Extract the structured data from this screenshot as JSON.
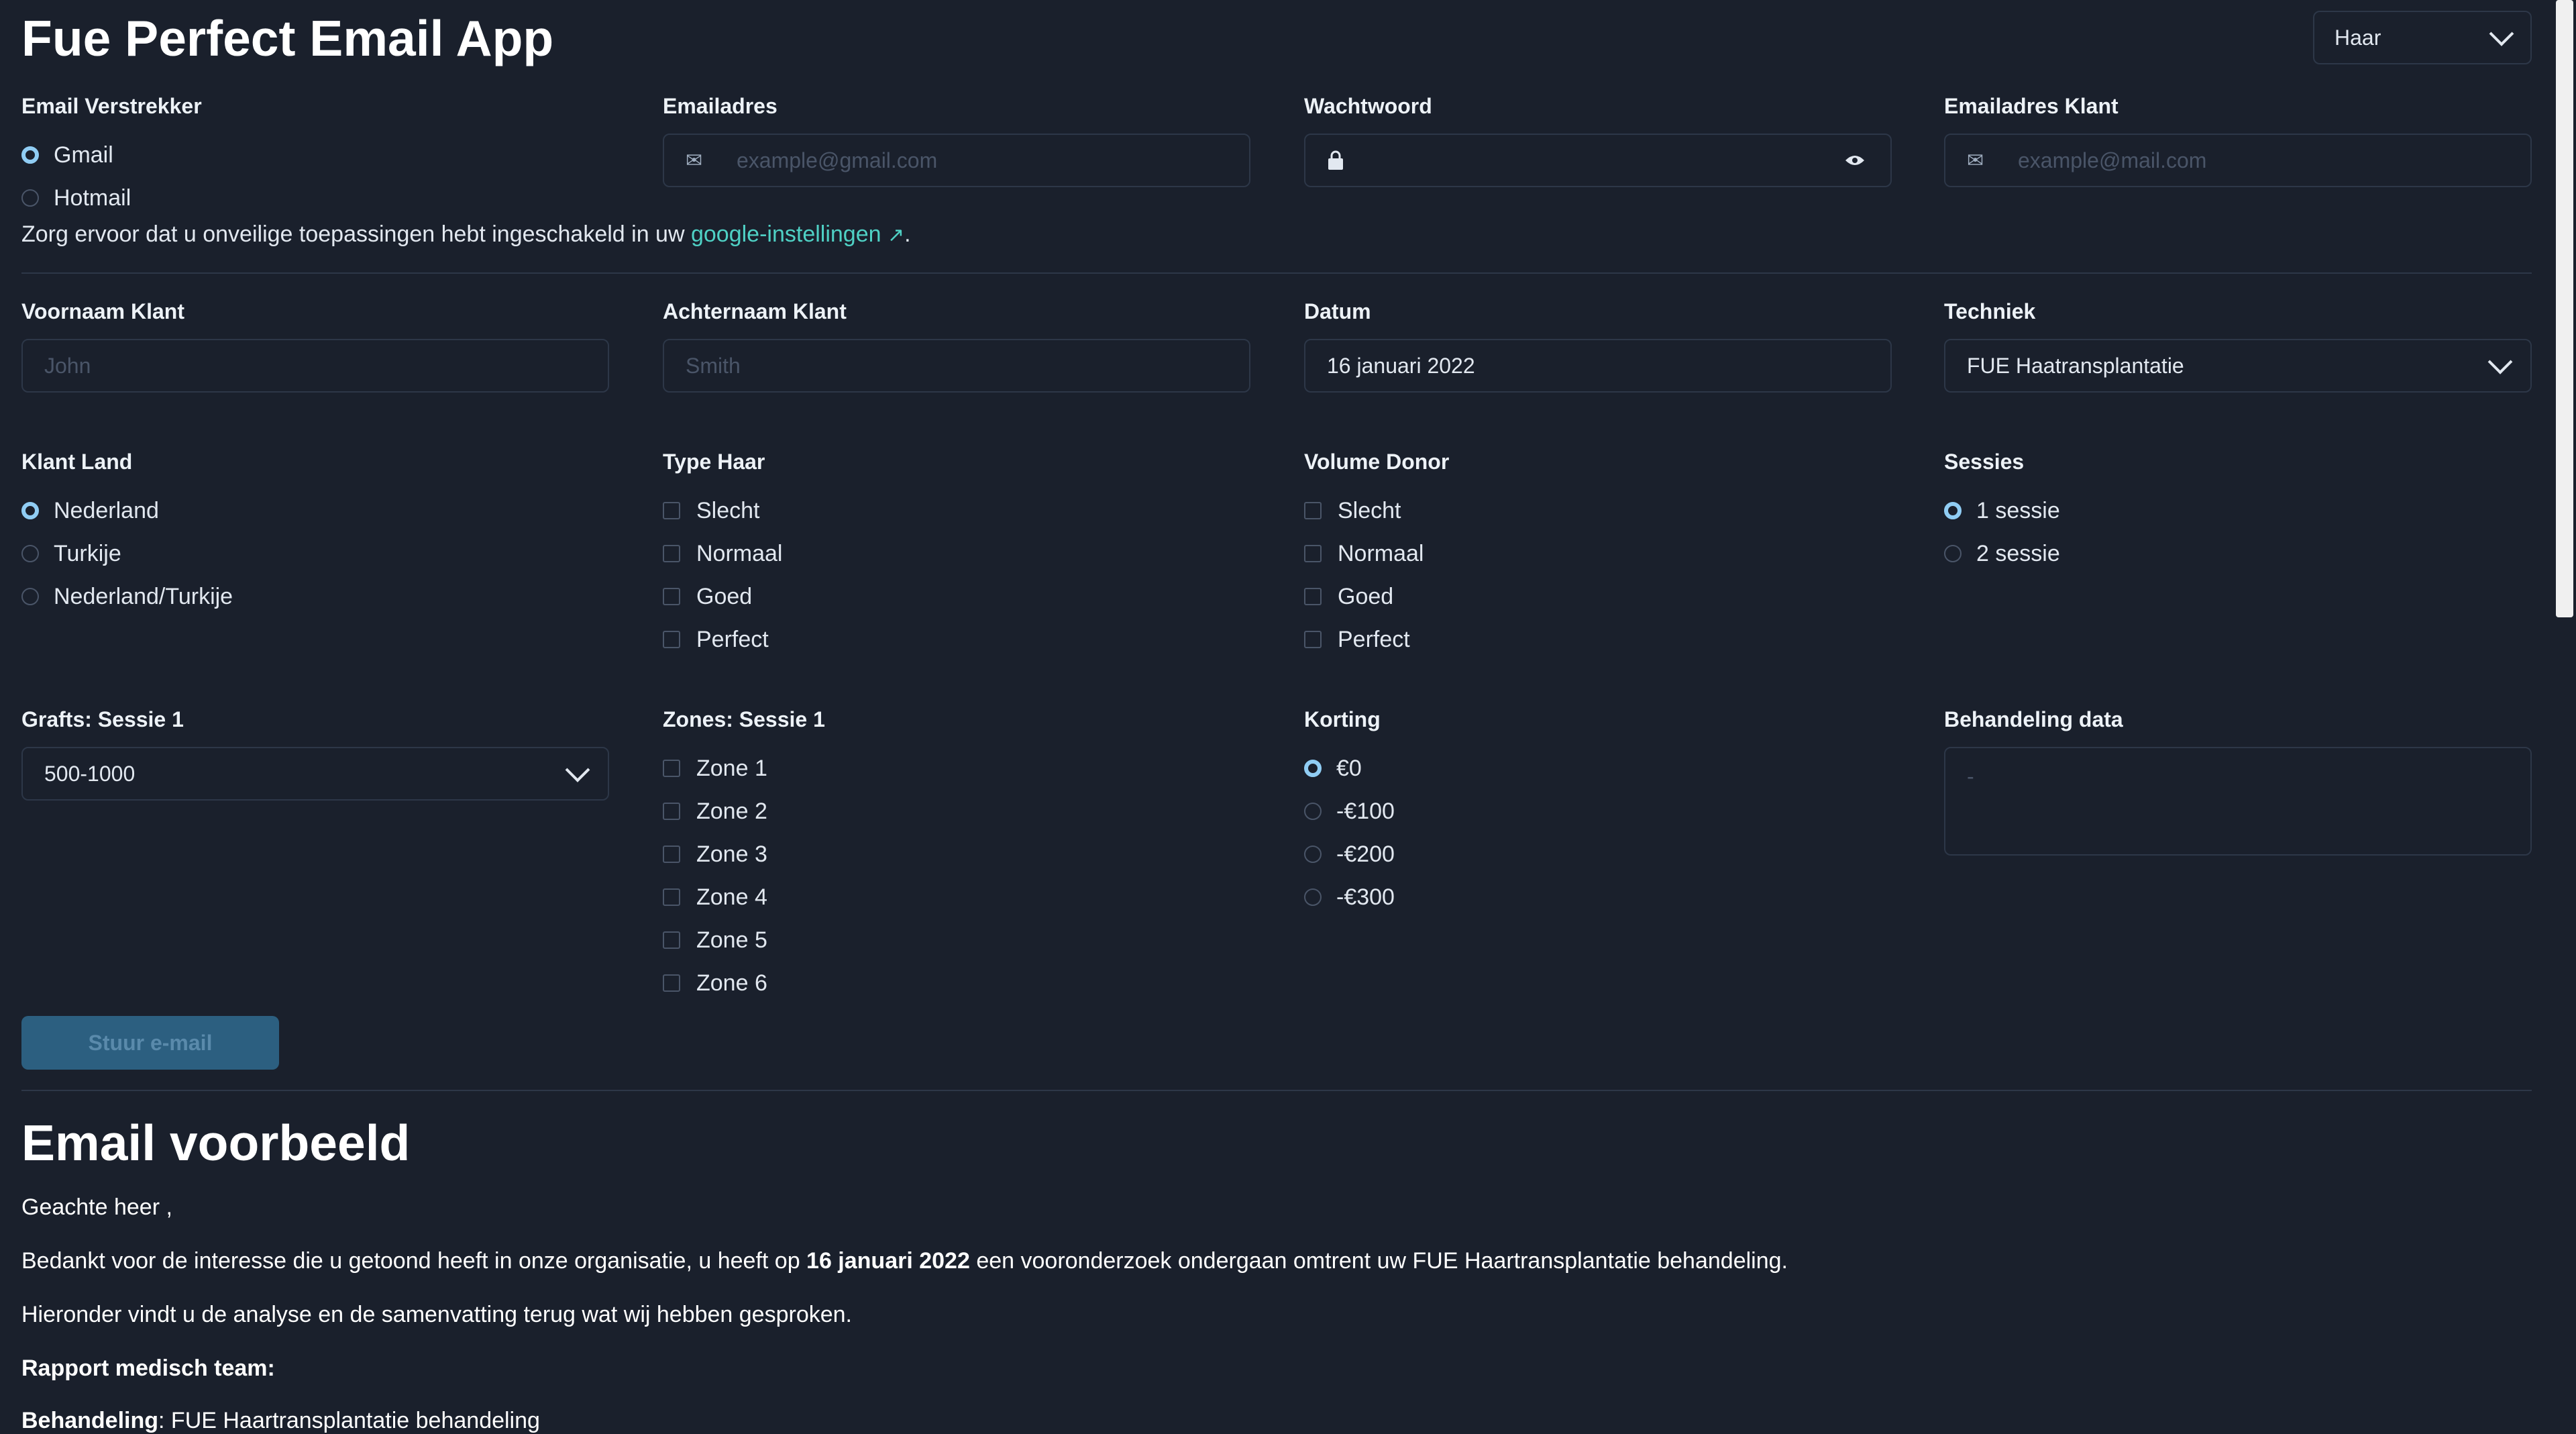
{
  "header": {
    "title": "Fue Perfect Email App",
    "language": "Haar"
  },
  "provider": {
    "label": "Email Verstrekker",
    "options": [
      "Gmail",
      "Hotmail"
    ],
    "selected": "Gmail"
  },
  "email": {
    "label": "Emailadres",
    "placeholder": "example@gmail.com"
  },
  "password": {
    "label": "Wachtwoord"
  },
  "client_email": {
    "label": "Emailadres Klant",
    "placeholder": "example@mail.com"
  },
  "notice": {
    "text_before": "Zorg ervoor dat u onveilige toepassingen hebt ingeschakeld in uw ",
    "link": "google-instellingen",
    "text_after": "."
  },
  "first_name": {
    "label": "Voornaam Klant",
    "placeholder": "John"
  },
  "last_name": {
    "label": "Achternaam Klant",
    "placeholder": "Smith"
  },
  "date": {
    "label": "Datum",
    "value": "16 januari 2022"
  },
  "technique": {
    "label": "Techniek",
    "value": "FUE Haatransplantatie"
  },
  "country": {
    "label": "Klant Land",
    "options": [
      "Nederland",
      "Turkije",
      "Nederland/Turkije"
    ],
    "selected": "Nederland"
  },
  "hair_type": {
    "label": "Type Haar",
    "options": [
      "Slecht",
      "Normaal",
      "Goed",
      "Perfect"
    ]
  },
  "donor_volume": {
    "label": "Volume Donor",
    "options": [
      "Slecht",
      "Normaal",
      "Goed",
      "Perfect"
    ]
  },
  "sessions": {
    "label": "Sessies",
    "options": [
      "1 sessie",
      "2 sessie"
    ],
    "selected": "1 sessie"
  },
  "grafts": {
    "label": "Grafts: Sessie 1",
    "value": "500-1000"
  },
  "zones": {
    "label": "Zones: Sessie 1",
    "options": [
      "Zone 1",
      "Zone 2",
      "Zone 3",
      "Zone 4",
      "Zone 5",
      "Zone 6"
    ]
  },
  "discount": {
    "label": "Korting",
    "options": [
      "€0",
      "-€100",
      "-€200",
      "-€300"
    ],
    "selected": "€0"
  },
  "treatment_data": {
    "label": "Behandeling data",
    "placeholder": "-"
  },
  "send_button": "Stuur e-mail",
  "preview": {
    "title": "Email voorbeeld",
    "greeting": "Geachte heer ,",
    "line1_before": "Bedankt voor de interesse die u getoond heeft in onze organisatie, u heeft op ",
    "line1_date": "16 januari 2022",
    "line1_after": " een vooronderzoek ondergaan omtrent uw FUE Haartransplantatie behandeling.",
    "line2": "Hieronder vindt u de analyse en de samenvatting terug wat wij hebben gesproken.",
    "report_heading": "Rapport medisch team:",
    "treatment_label": "Behandeling",
    "treatment_value": ": FUE Haartransplantatie behandeling"
  }
}
